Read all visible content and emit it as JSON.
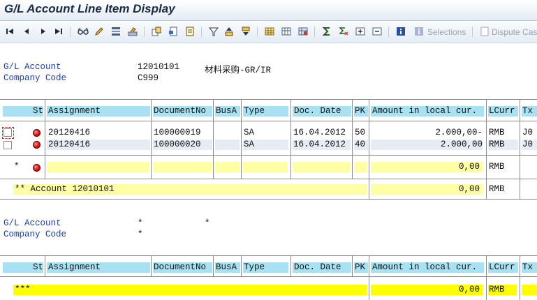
{
  "title": "G/L Account Line Item Display",
  "toolbar": {
    "selections_label": "Selections",
    "dispute_label": "Dispute Cas"
  },
  "colors": {
    "header_bg": "#a8e2f2",
    "subtotal_bg": "#ffffa6",
    "total_bg": "#ffff00",
    "status": "#e01010",
    "label_blue": "#1d3fa0"
  },
  "block1": {
    "gl_account_label": "G/L Account",
    "gl_account_value": "12010101",
    "gl_account_desc": "材料采购-GR/IR",
    "company_code_label": "Company Code",
    "company_code_value": "C999"
  },
  "block2": {
    "gl_account_label": "G/L Account",
    "gl_account_value": "*",
    "gl_account_desc": "*",
    "company_code_label": "Company Code",
    "company_code_value": "*"
  },
  "columns": {
    "st": "St",
    "assignment": "Assignment",
    "document_no": "DocumentNo",
    "bus_a": "BusA",
    "type": "Type",
    "doc_date": "Doc. Date",
    "pk": "PK",
    "amount": "Amount in local cur.",
    "lcurr": "LCurr",
    "tx": "Tx"
  },
  "rows": [
    {
      "status": "red",
      "assignment": "20120416",
      "document_no": "100000019",
      "bus_a": "",
      "type": "SA",
      "doc_date": "16.04.2012",
      "pk": "50",
      "amount": "2.000,00-",
      "lcurr": "RMB",
      "tx": "J0"
    },
    {
      "status": "red",
      "assignment": "20120416",
      "document_no": "100000020",
      "bus_a": "",
      "type": "SA",
      "doc_date": "16.04.2012",
      "pk": "40",
      "amount": "2.000,00",
      "lcurr": "RMB",
      "tx": "J0"
    }
  ],
  "subtotal": {
    "marker": "*",
    "amount": "0,00",
    "lcurr": "RMB"
  },
  "account_total": {
    "label": "** Account 12010101",
    "amount": "0,00",
    "lcurr": "RMB"
  },
  "grand_total": {
    "label": "***",
    "amount": "0,00",
    "lcurr": "RMB"
  }
}
